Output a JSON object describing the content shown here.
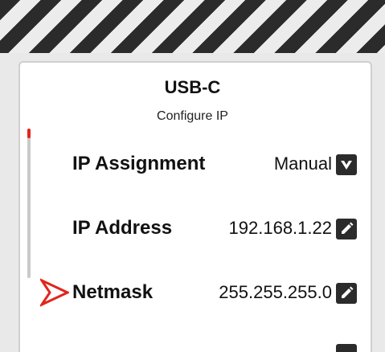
{
  "header": {
    "title": "USB-C",
    "subtitle": "Configure IP"
  },
  "rows": [
    {
      "label": "IP Assignment",
      "value": "Manual",
      "action_icon": "dropdown-arrow-icon"
    },
    {
      "label": "IP Address",
      "value": "192.168.1.22",
      "action_icon": "pencil-icon"
    },
    {
      "label": "Netmask",
      "value": "255.255.255.0",
      "action_icon": "pencil-icon"
    }
  ],
  "colors": {
    "accent": "#e1261c",
    "button": "#2b2b2b",
    "hazard_dark": "#2b2b2b"
  }
}
